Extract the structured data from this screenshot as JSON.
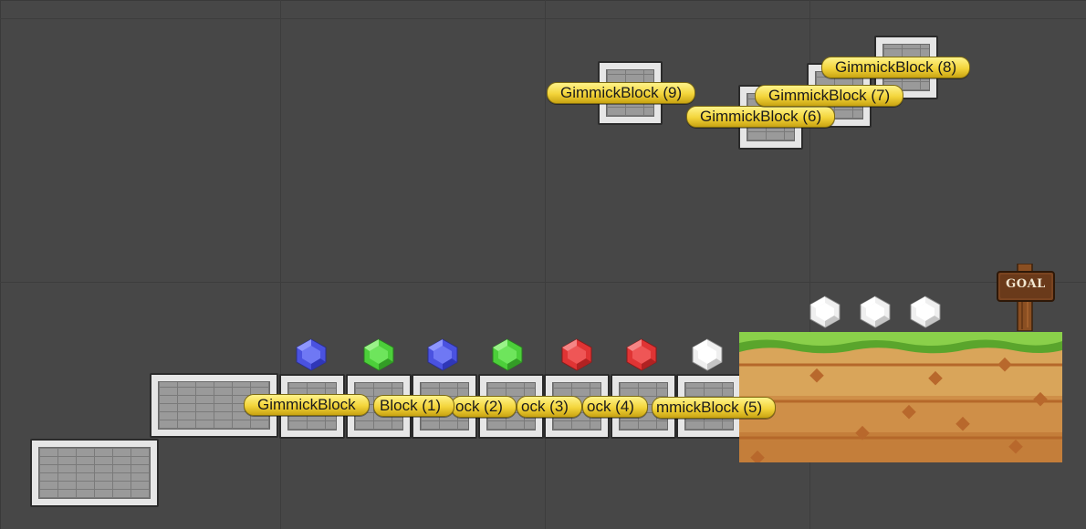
{
  "scene": {
    "background_color": "#474747",
    "label_color": "#f3d43a",
    "gem_colors": {
      "blue": "#4a52e0",
      "green": "#4ccf3a",
      "red": "#e03434",
      "white": "#efefef"
    }
  },
  "labels": [
    {
      "key": "gb",
      "text": "GimmickBlock"
    },
    {
      "key": "gb1",
      "text": "Block (1)"
    },
    {
      "key": "gb2",
      "text": "ock (2)"
    },
    {
      "key": "gb3",
      "text": "ock (3)"
    },
    {
      "key": "gb4",
      "text": "ock (4)"
    },
    {
      "key": "gb5",
      "text": "mmickBlock (5)"
    },
    {
      "key": "gb6",
      "text": "GimmickBlock (6)"
    },
    {
      "key": "gb7",
      "text": "GimmickBlock (7)"
    },
    {
      "key": "gb8",
      "text": "GimmickBlock (8)"
    },
    {
      "key": "gb9",
      "text": "GimmickBlock (9)"
    }
  ],
  "gems": [
    "blue",
    "green",
    "blue",
    "green",
    "red",
    "red",
    "white",
    "white",
    "white",
    "white"
  ],
  "goal_sign": {
    "text": "GOAL"
  }
}
